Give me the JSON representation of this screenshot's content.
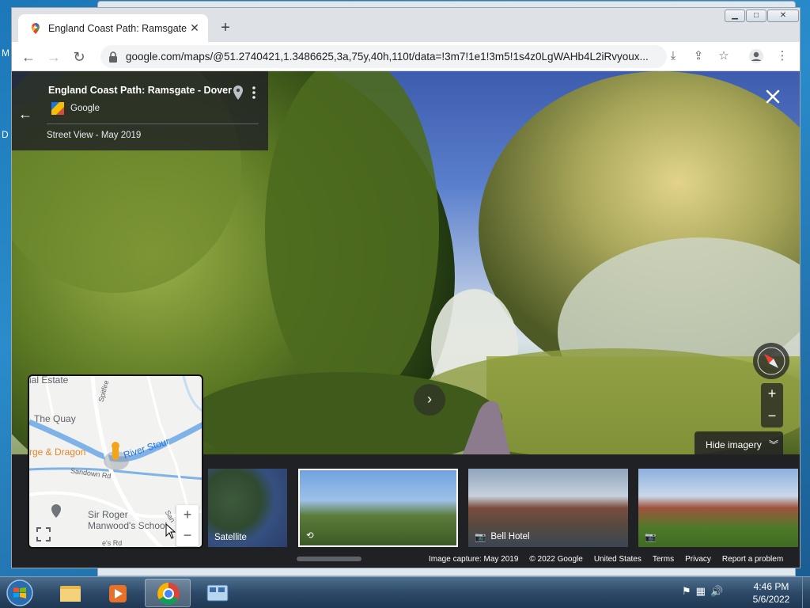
{
  "desktop": {
    "frag_top": "M",
    "frag_mid": "D"
  },
  "browser": {
    "tab_title": "England Coast Path: Ramsgate - Dover",
    "url": "google.com/maps/@51.2740421,1.3486625,3a,75y,40h,110t/data=!3m7!1e1!3m5!1s4z0LgWAHb4L2iRvyoux...",
    "window_min": "▁",
    "window_max": "□",
    "window_close": "✕"
  },
  "place": {
    "title": "England Coast Path: Ramsgate - Dover",
    "provider": "Google",
    "date": "Street View - May 2019"
  },
  "controls": {
    "zoom_in": "+",
    "zoom_out": "−",
    "hide_imagery": "Hide imagery",
    "next_arrow": "›"
  },
  "filmstrip": {
    "thumbs": [
      {
        "label": "Satellite"
      },
      {
        "label": ""
      },
      {
        "label": "Bell Hotel"
      },
      {
        "label": ""
      }
    ]
  },
  "footer": {
    "capture": "Image capture: May 2019",
    "copyright": "© 2022 Google",
    "region": "United States",
    "terms": "Terms",
    "privacy": "Privacy",
    "report": "Report a problem"
  },
  "minimap": {
    "labels": {
      "estate": "ial Estate",
      "quay": "The Quay",
      "dragon": "rge & Dragon",
      "river": "River Stour",
      "sandown": "Sandown Rd",
      "school": "Sir Roger\nManwood's School",
      "spitfire": "Spitfire",
      "san": "San",
      "rd": "e's Rd"
    }
  },
  "taskbar": {
    "time": "4:46 PM",
    "date": "5/6/2022"
  },
  "colors": {
    "accent_chrome": "#1a73e8",
    "river": "#7fb3e8",
    "pegman": "#f2a51a"
  }
}
